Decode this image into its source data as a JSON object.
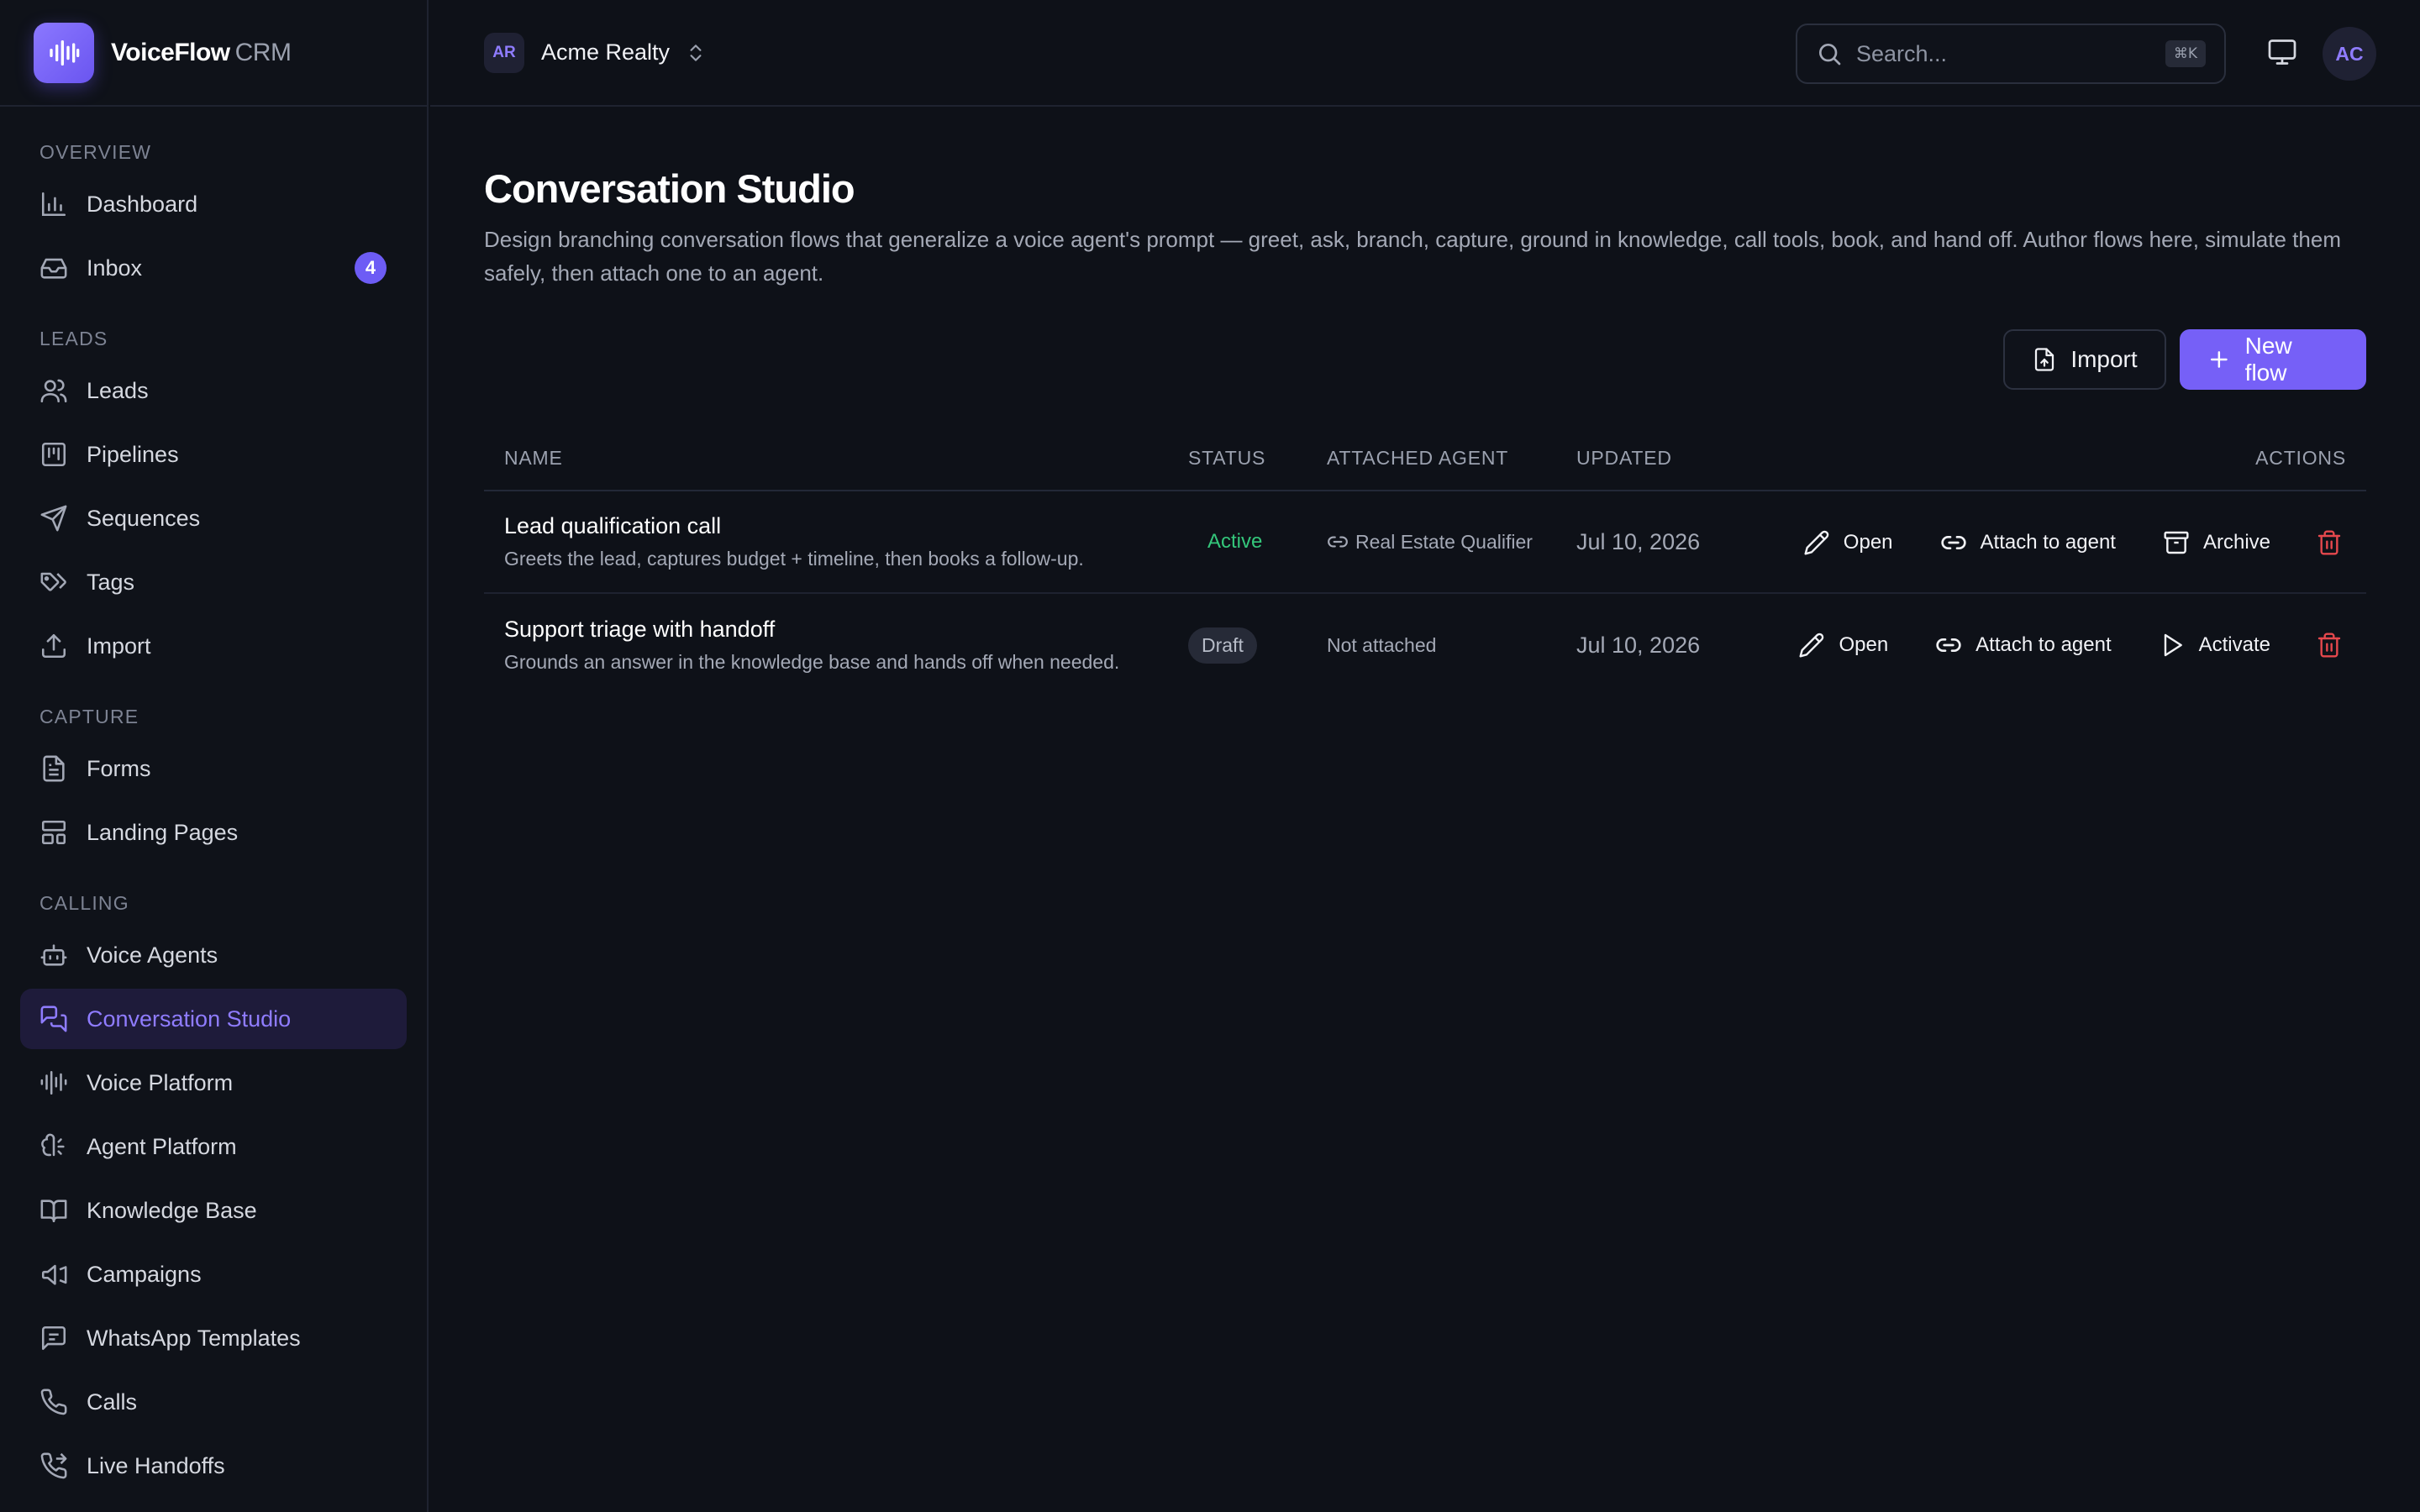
{
  "brand": {
    "name": "VoiceFlow",
    "suffix": "CRM",
    "logo_icon": "waveform-icon"
  },
  "sidebar": {
    "sections": [
      {
        "title": "OVERVIEW",
        "items": [
          {
            "label": "Dashboard",
            "icon": "bar-chart-icon"
          },
          {
            "label": "Inbox",
            "icon": "inbox-icon",
            "badge": "4"
          }
        ]
      },
      {
        "title": "LEADS",
        "items": [
          {
            "label": "Leads",
            "icon": "users-icon"
          },
          {
            "label": "Pipelines",
            "icon": "kanban-icon"
          },
          {
            "label": "Sequences",
            "icon": "send-icon"
          },
          {
            "label": "Tags",
            "icon": "tags-icon"
          },
          {
            "label": "Import",
            "icon": "upload-icon"
          }
        ]
      },
      {
        "title": "CAPTURE",
        "items": [
          {
            "label": "Forms",
            "icon": "file-text-icon"
          },
          {
            "label": "Landing Pages",
            "icon": "layout-icon"
          }
        ]
      },
      {
        "title": "CALLING",
        "items": [
          {
            "label": "Voice Agents",
            "icon": "bot-icon"
          },
          {
            "label": "Conversation Studio",
            "icon": "messages-icon",
            "active": true
          },
          {
            "label": "Voice Platform",
            "icon": "audio-lines-icon"
          },
          {
            "label": "Agent Platform",
            "icon": "agent-icon"
          },
          {
            "label": "Knowledge Base",
            "icon": "book-open-icon"
          },
          {
            "label": "Campaigns",
            "icon": "megaphone-icon"
          },
          {
            "label": "WhatsApp Templates",
            "icon": "message-square-icon"
          },
          {
            "label": "Calls",
            "icon": "phone-icon"
          },
          {
            "label": "Live Handoffs",
            "icon": "phone-forward-icon"
          }
        ]
      }
    ]
  },
  "topbar": {
    "org_initials": "AR",
    "org_name": "Acme Realty",
    "search_placeholder": "Search...",
    "search_shortcut": "⌘K",
    "user_initials": "AC"
  },
  "page": {
    "title": "Conversation Studio",
    "description": "Design branching conversation flows that generalize a voice agent's prompt — greet, ask, branch, capture, ground in knowledge, call tools, book, and hand off. Author flows here, simulate them safely, then attach one to an agent.",
    "import_label": "Import",
    "new_flow_label": "New flow"
  },
  "table": {
    "headers": {
      "name": "NAME",
      "status": "STATUS",
      "agent": "ATTACHED AGENT",
      "updated": "UPDATED",
      "actions": "ACTIONS"
    },
    "rows": [
      {
        "name": "Lead qualification call",
        "description": "Greets the lead, captures budget + timeline, then books a follow-up.",
        "status": "Active",
        "agent": "Real Estate Qualifier",
        "updated": "Jul 10, 2026",
        "actions": {
          "open": "Open",
          "attach": "Attach to agent",
          "third": "Archive"
        }
      },
      {
        "name": "Support triage with handoff",
        "description": "Grounds an answer in the knowledge base and hands off when needed.",
        "status": "Draft",
        "agent": "Not attached",
        "updated": "Jul 10, 2026",
        "actions": {
          "open": "Open",
          "attach": "Attach to agent",
          "third": "Activate"
        }
      }
    ]
  },
  "colors": {
    "accent": "#7660f7",
    "active_nav_bg": "#1e1b3a",
    "status_active": "#34c77b",
    "delete": "#e5484d",
    "background": "#0e1118"
  }
}
